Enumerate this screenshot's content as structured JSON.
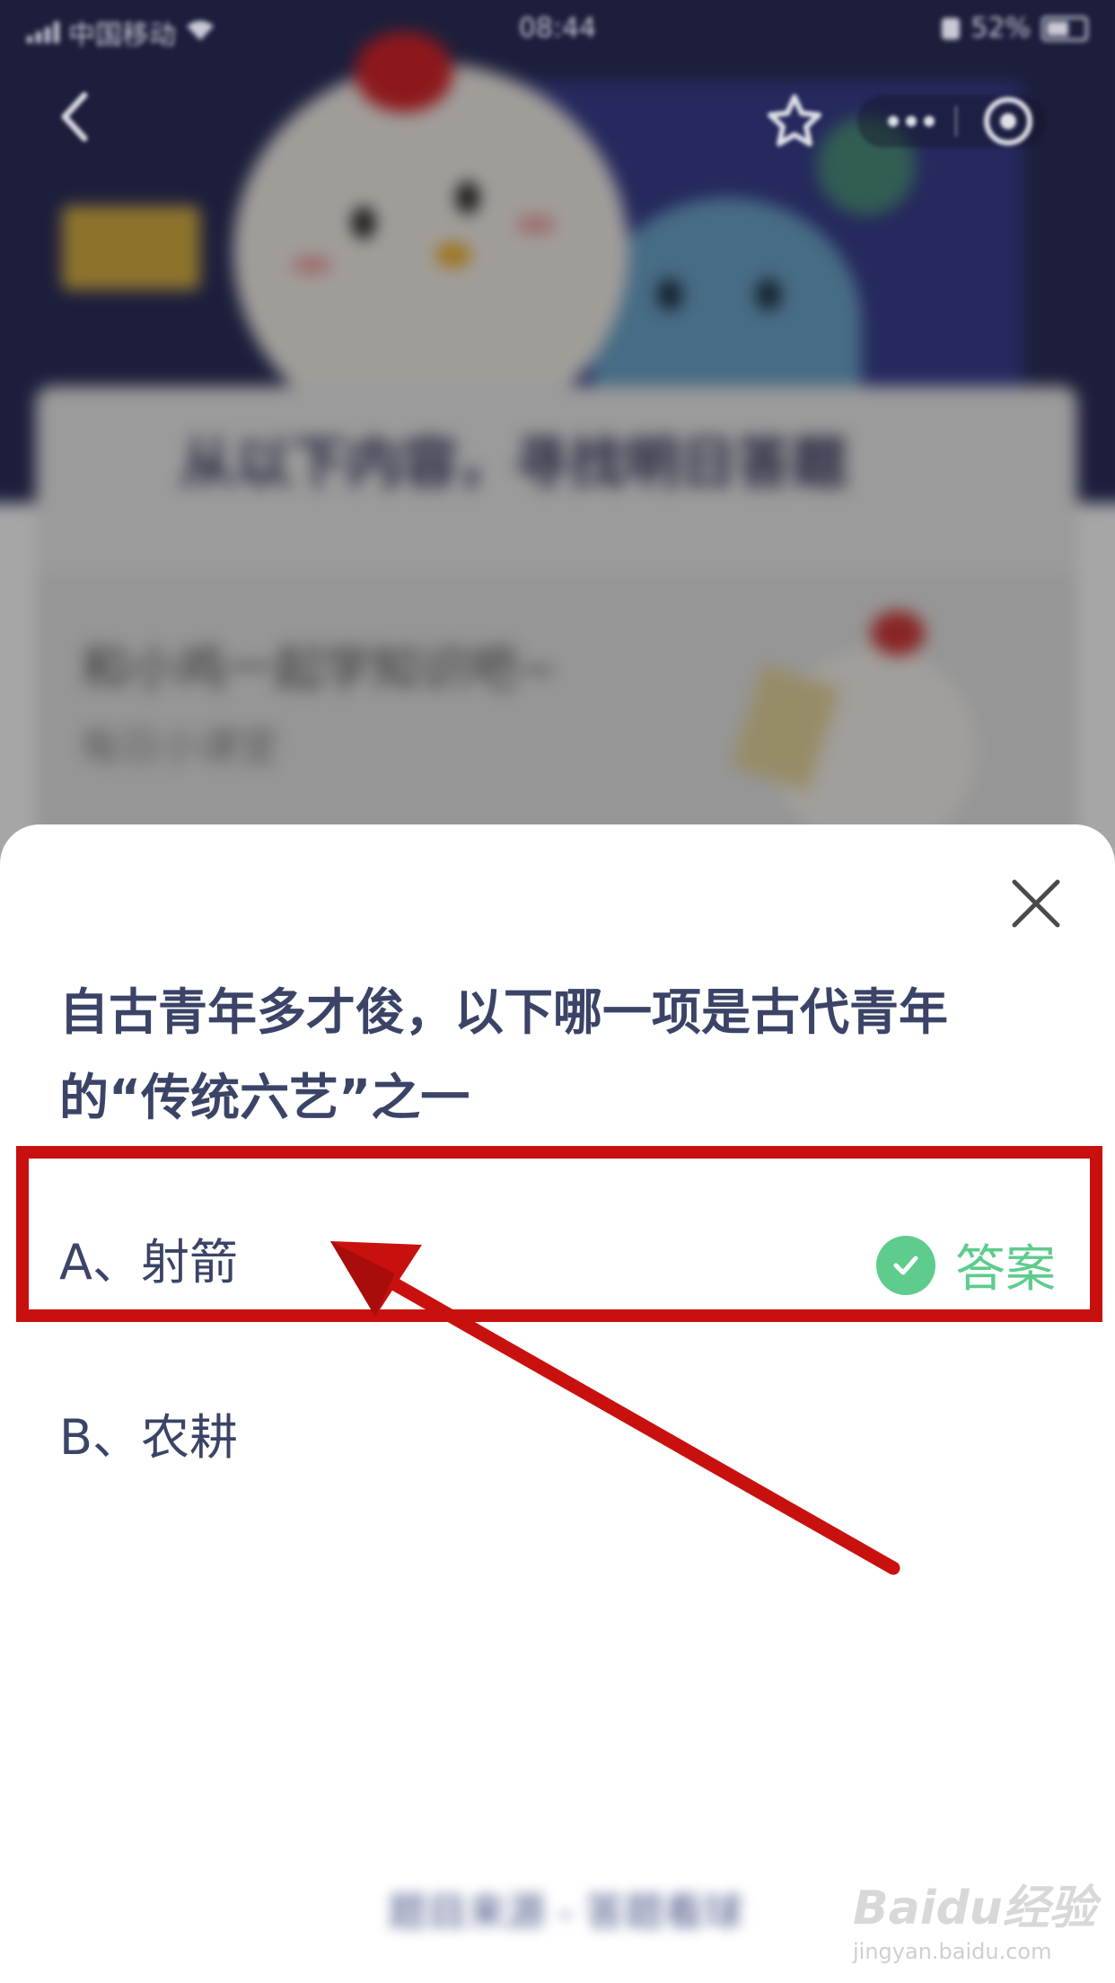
{
  "status_bar": {
    "carrier": "中国移动",
    "time": "08:44",
    "battery": "52%"
  },
  "background": {
    "card_title": "从以下内容，寻找明日答题",
    "lesson_title": "和小鸡一起学知识吧~",
    "lesson_subtitle": "每日小课堂"
  },
  "quiz": {
    "question": "自古青年多才俊，以下哪一项是古代青年的“传统六艺”之一",
    "options": [
      {
        "label": "A、射箭",
        "answer_label": "答案"
      },
      {
        "label": "B、农耕"
      }
    ],
    "bottom_link": "题目来源 - 答题看球"
  },
  "watermark": {
    "brand": "Baidu经验",
    "url": "jingyan.baidu.com"
  },
  "colors": {
    "accent_green": "#5dcc8c",
    "highlight_red": "#c8110f",
    "text": "#3b4467"
  },
  "icons": [
    "back-icon",
    "star-icon",
    "more-icon",
    "target-icon",
    "close-icon",
    "check-icon",
    "arrow-annotation"
  ]
}
